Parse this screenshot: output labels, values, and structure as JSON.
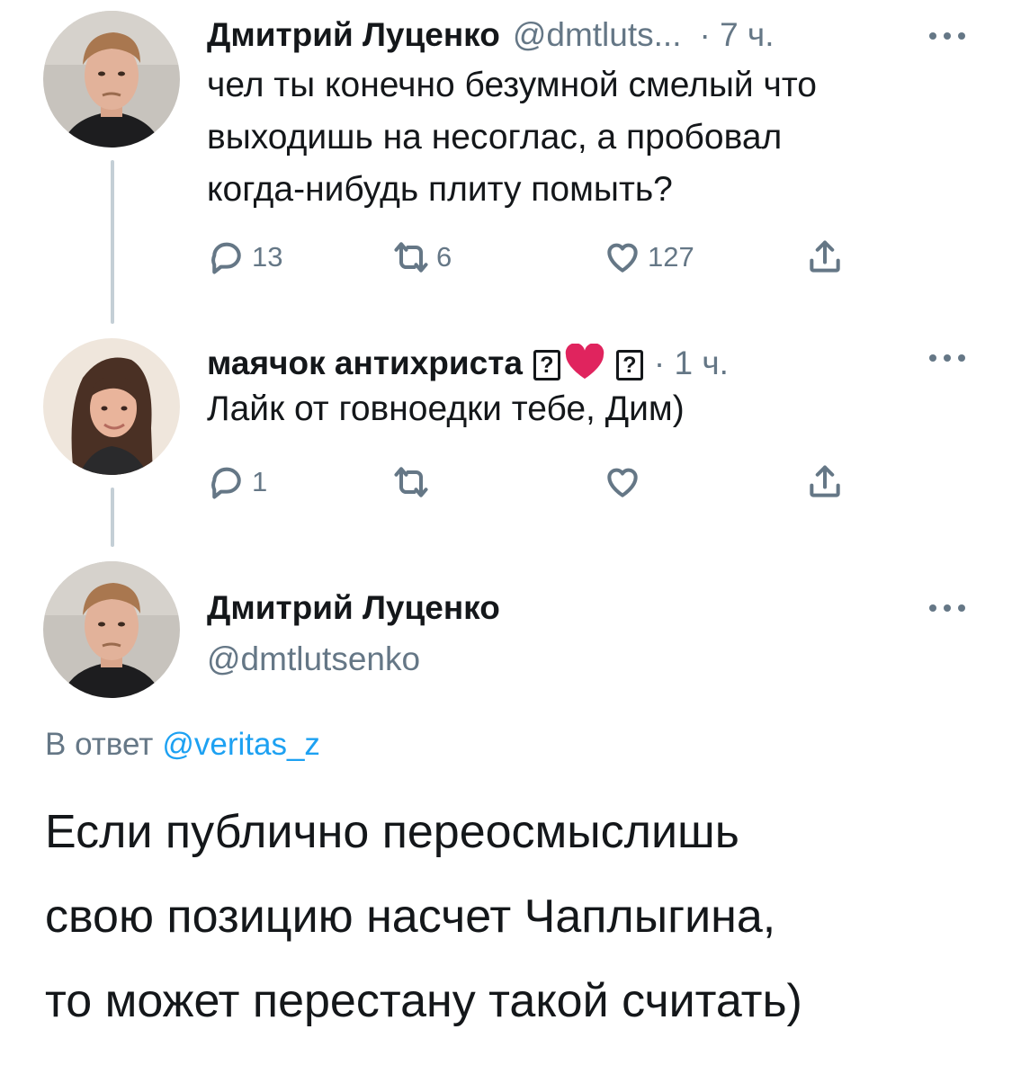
{
  "tweets": [
    {
      "name": "Дмитрий Луценко",
      "handle": "@dmtluts...",
      "time": "· 7 ч.",
      "text_lines": [
        "чел ты конечно безумной смелый что",
        "выходишь на несоглас, а пробовал",
        "когда-нибудь плиту помыть?"
      ],
      "actions": {
        "replies": "13",
        "retweets": "6",
        "likes": "127"
      },
      "avatar": "man-avatar"
    },
    {
      "name": "маячок антихриста",
      "name_emoji_box": "?",
      "name_emoji_heart": "heart",
      "name_emoji_box2": "?",
      "time": "· 1 ч.",
      "text_lines": [
        "Лайк от говноедки тебе, Дим)"
      ],
      "actions": {
        "replies": "1",
        "retweets": "",
        "likes": ""
      },
      "avatar": "woman-avatar"
    }
  ],
  "main_tweet": {
    "name": "Дмитрий Луценко",
    "handle": "@dmtlutsenko",
    "reply_prefix": "В ответ",
    "reply_mention": "@veritas_z",
    "text_lines": [
      "Если публично переосмыслишь",
      "свою позицию насчет Чаплыгина,",
      "то может перестану такой считать)"
    ],
    "avatar": "man-avatar"
  },
  "colors": {
    "text": "#14171a",
    "secondary": "#657786",
    "link": "#1da1f2",
    "thread_line": "#c4cfd6",
    "heart": "#e0245e"
  }
}
